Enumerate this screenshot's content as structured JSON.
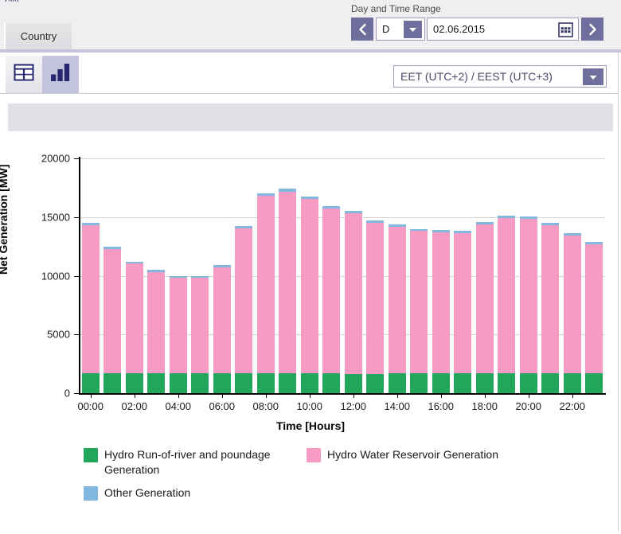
{
  "window": {
    "clipped_title": "[%]"
  },
  "tabs": [
    {
      "label": "Country",
      "active": true
    }
  ],
  "date_range": {
    "label": "Day and Time Range",
    "prev_icon": "chevron-left-icon",
    "next_icon": "chevron-right-icon",
    "granularity_value": "D",
    "granularity_arrow_icon": "chevron-down-icon",
    "date_value": "02.06.2015",
    "calendar_icon": "calendar-icon"
  },
  "toolbar": {
    "table_view_icon": "table-grid-icon",
    "chart_view_icon": "bar-chart-icon",
    "active_view": "chart"
  },
  "timezone": {
    "value": "EET (UTC+2) / EEST (UTC+3)",
    "arrow_icon": "chevron-down-icon"
  },
  "colors": {
    "accent": "#6f6f9e",
    "accent_light": "#c3c3dc",
    "green": "#21a65b",
    "pink": "#f79bc5",
    "blue": "#81b8e0",
    "grid": "#d4d4d4",
    "band": "#e0e0e6"
  },
  "chart_data": {
    "type": "bar",
    "stacked": true,
    "title": "",
    "xlabel": "Time [Hours]",
    "ylabel": "Net Generation [MW]",
    "ylim": [
      0,
      20000
    ],
    "yticks": [
      0,
      5000,
      10000,
      15000,
      20000
    ],
    "ytick_labels": [
      "0",
      "5000",
      "10000",
      "15000",
      "20000"
    ],
    "grid": true,
    "legend_position": "bottom-left",
    "categories": [
      "00:00",
      "01:00",
      "02:00",
      "03:00",
      "04:00",
      "05:00",
      "06:00",
      "07:00",
      "08:00",
      "09:00",
      "10:00",
      "11:00",
      "12:00",
      "13:00",
      "14:00",
      "15:00",
      "16:00",
      "17:00",
      "18:00",
      "19:00",
      "20:00",
      "21:00",
      "22:00",
      "23:00"
    ],
    "xtick_labels": [
      "00:00",
      "02:00",
      "04:00",
      "06:00",
      "08:00",
      "10:00",
      "12:00",
      "14:00",
      "16:00",
      "18:00",
      "20:00",
      "22:00"
    ],
    "series": [
      {
        "name": "Hydro Run-of-river and poundage Generation",
        "color": "#21a65b",
        "values": [
          1680,
          1680,
          1680,
          1680,
          1680,
          1680,
          1680,
          1680,
          1680,
          1680,
          1680,
          1680,
          1600,
          1620,
          1700,
          1700,
          1700,
          1700,
          1700,
          1700,
          1700,
          1700,
          1700,
          1700
        ]
      },
      {
        "name": "Hydro Water Reservoir Generation",
        "color": "#f79bc5",
        "values": [
          12650,
          10600,
          9350,
          8650,
          8130,
          8130,
          9050,
          12350,
          15150,
          15500,
          14850,
          14050,
          13700,
          12900,
          12450,
          12100,
          12000,
          11900,
          12700,
          13250,
          13150,
          12600,
          11750,
          10950
        ]
      },
      {
        "name": "Other Generation",
        "color": "#81b8e0",
        "values": [
          200,
          180,
          180,
          170,
          170,
          170,
          180,
          200,
          220,
          220,
          220,
          210,
          210,
          200,
          200,
          200,
          200,
          200,
          200,
          200,
          200,
          200,
          200,
          200
        ]
      }
    ],
    "totals": [
      14530,
      12460,
      11210,
      10500,
      9980,
      9980,
      10910,
      14230,
      17050,
      17400,
      16750,
      15940,
      15510,
      14720,
      14350,
      14000,
      13900,
      13800,
      14600,
      15150,
      15050,
      14500,
      13650,
      12850
    ]
  },
  "legend": [
    {
      "label": "Hydro Run-of-river and poundage Generation",
      "color": "#21a65b"
    },
    {
      "label": "Hydro Water Reservoir Generation",
      "color": "#f79bc5"
    },
    {
      "label": "Other Generation",
      "color": "#81b8e0"
    }
  ]
}
